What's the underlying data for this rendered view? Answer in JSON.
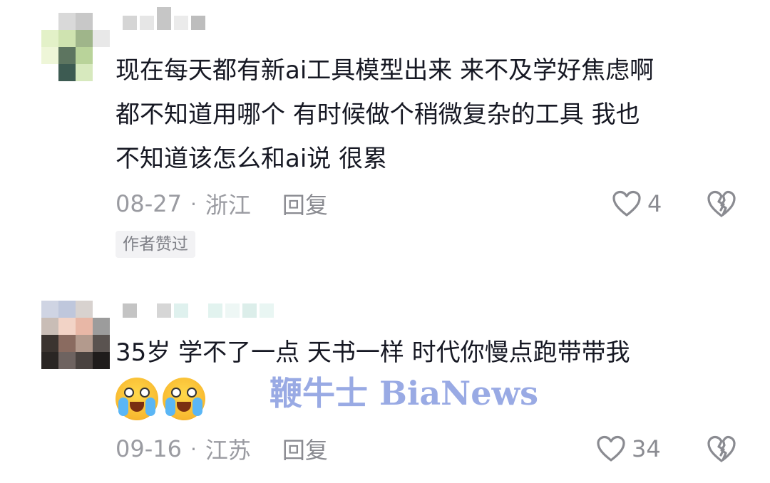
{
  "comments": [
    {
      "content": "现在每天都有新ai工具模型出来 来不及学好焦虑啊\n都不知道用哪个 有时候做个稍微复杂的工具 我也\n不知道该怎么和ai说 很累",
      "date": "08-27",
      "location": "浙江",
      "reply_label": "回复",
      "likes": "4",
      "badge": "作者赞过"
    },
    {
      "content": "35岁 学不了一点 天书一样 时代你慢点跑带带我",
      "emojis": [
        "crying-laughing-emoji",
        "crying-laughing-emoji"
      ],
      "date": "09-16",
      "location": "江苏",
      "reply_label": "回复",
      "likes": "34"
    }
  ],
  "separator": "·",
  "watermark": "鞭牛士 BiaNews",
  "colors": {
    "text_primary": "#161823",
    "text_meta": "#9a9ba1",
    "badge_bg": "#f2f2f4",
    "watermark": "#4664cd"
  }
}
